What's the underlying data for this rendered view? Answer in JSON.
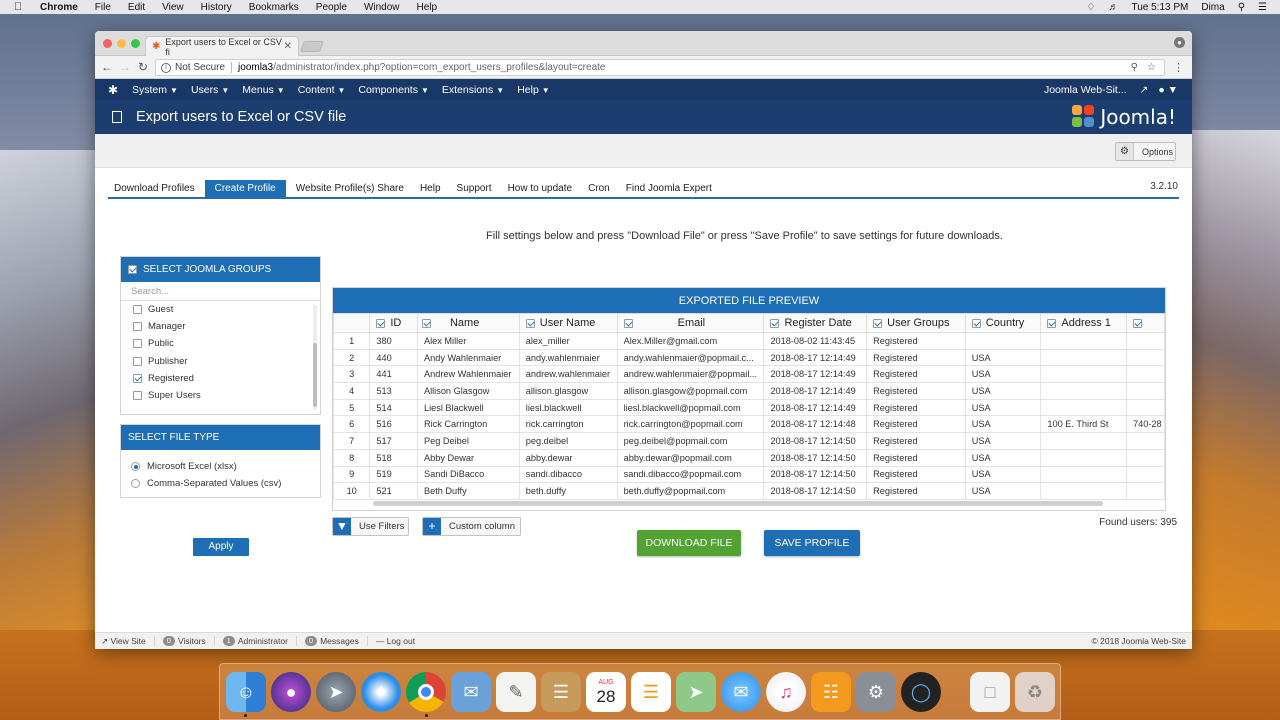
{
  "menubar": {
    "app": "Chrome",
    "items": [
      "File",
      "Edit",
      "View",
      "History",
      "Bookmarks",
      "People",
      "Window",
      "Help"
    ],
    "clock": "Tue 5:13 PM",
    "user": "Dima"
  },
  "browser": {
    "tab_title": "Export users to Excel or CSV fi",
    "not_secure": "Not Secure",
    "url_host": "joomla3",
    "url_path": "/administrator/index.php?option=com_export_users_profiles&layout=create"
  },
  "joomla_nav": {
    "items": [
      "System",
      "Users",
      "Menus",
      "Content",
      "Components",
      "Extensions",
      "Help"
    ],
    "site_link": "Joomla Web-Sit...",
    "brand": "Joomla!"
  },
  "header": {
    "title": "Export users to Excel or CSV file"
  },
  "toolbar": {
    "options_label": "Options"
  },
  "tabs": [
    {
      "label": "Download Profiles",
      "active": false
    },
    {
      "label": "Create Profile",
      "active": true
    },
    {
      "label": "Website Profile(s) Share",
      "active": false
    },
    {
      "label": "Help",
      "active": false
    },
    {
      "label": "Support",
      "active": false
    },
    {
      "label": "How to update",
      "active": false
    },
    {
      "label": "Cron",
      "active": false
    },
    {
      "label": "Find Joomla Expert",
      "active": false
    }
  ],
  "version": "3.2.10",
  "hint": "Fill settings below and press \"Download File\" or press \"Save Profile\" to save settings for future downloads.",
  "groups_panel": {
    "title": "SELECT JOOMLA GROUPS",
    "search_placeholder": "Search...",
    "groups": [
      {
        "label": "Guest",
        "checked": false
      },
      {
        "label": "Manager",
        "checked": false
      },
      {
        "label": "Public",
        "checked": false
      },
      {
        "label": "Publisher",
        "checked": false
      },
      {
        "label": "Registered",
        "checked": true
      },
      {
        "label": "Super Users",
        "checked": false
      }
    ]
  },
  "filetype_panel": {
    "title": "SELECT FILE TYPE",
    "options": [
      {
        "label": "Microsoft Excel (xlsx)",
        "selected": true
      },
      {
        "label": "Comma-Separated Values (csv)",
        "selected": false
      }
    ],
    "apply_label": "Apply"
  },
  "preview": {
    "title": "EXPORTED FILE PREVIEW",
    "columns": [
      "",
      "ID",
      "Name",
      "User Name",
      "Email",
      "Register Date",
      "User Groups",
      "Country",
      "Address 1",
      ""
    ],
    "rows": [
      [
        "1",
        "380",
        "Alex Miller",
        "alex_miller",
        "Alex.Miller@gmail.com",
        "2018-08-02 11:43:45",
        "Registered",
        "",
        "",
        ""
      ],
      [
        "2",
        "440",
        "Andy Wahlenmaier",
        "andy.wahlenmaier",
        "andy.wahlenmaier@popmail.c...",
        "2018-08-17 12:14:49",
        "Registered",
        "USA",
        "",
        ""
      ],
      [
        "3",
        "441",
        "Andrew Wahlenmaier",
        "andrew.wahlenmaier",
        "andrew.wahlenmaier@popmail...",
        "2018-08-17 12:14:49",
        "Registered",
        "USA",
        "",
        ""
      ],
      [
        "4",
        "513",
        "Allison Glasgow",
        "allison.glasgow",
        "allison.glasgow@popmail.com",
        "2018-08-17 12:14:49",
        "Registered",
        "USA",
        "",
        ""
      ],
      [
        "5",
        "514",
        "Liesl Blackwell",
        "liesl.blackwell",
        "liesl.blackwell@popmail.com",
        "2018-08-17 12:14:49",
        "Registered",
        "USA",
        "",
        ""
      ],
      [
        "6",
        "516",
        "Rick Carrington",
        "rick.carrington",
        "rick.carrington@popmail.com",
        "2018-08-17 12:14:48",
        "Registered",
        "USA",
        "100 E. Third St",
        "740-28"
      ],
      [
        "7",
        "517",
        "Peg Deibel",
        "peg.deibel",
        "peg.deibel@popmail.com",
        "2018-08-17 12:14:50",
        "Registered",
        "USA",
        "",
        ""
      ],
      [
        "8",
        "518",
        "Abby Dewar",
        "abby.dewar",
        "abby.dewar@popmail.com",
        "2018-08-17 12:14:50",
        "Registered",
        "USA",
        "",
        ""
      ],
      [
        "9",
        "519",
        "Sandi DiBacco",
        "sandi.dibacco",
        "sandi.dibacco@popmail.com",
        "2018-08-17 12:14:50",
        "Registered",
        "USA",
        "",
        ""
      ],
      [
        "10",
        "521",
        "Beth Duffy",
        "beth.duffy",
        "beth.duffy@popmail.com",
        "2018-08-17 12:14:50",
        "Registered",
        "USA",
        "",
        ""
      ]
    ]
  },
  "actions": {
    "use_filters": "Use Filters",
    "custom_column": "Custom column",
    "found_users": "Found users: 395",
    "download_file": "DOWNLOAD FILE",
    "save_profile": "SAVE PROFILE"
  },
  "statusbar": {
    "view_site": "View Site",
    "visitors_count": "0",
    "visitors": "Visitors",
    "admin_count": "1",
    "administrator": "Administrator",
    "messages_count": "0",
    "messages": "Messages",
    "logout": "Log out",
    "copyright": "© 2018 Joomla Web-Site"
  },
  "dock": {
    "calendar_month": "AUG",
    "calendar_day": "28",
    "apps": [
      "Finder",
      "Siri",
      "Launchpad",
      "Safari",
      "Chrome",
      "Mail",
      "TextEdit",
      "Notes",
      "Calendar",
      "Reminders",
      "Maps",
      "Messages",
      "iTunes",
      "iBooks",
      "System Preferences",
      "QuickTime",
      "Document",
      "Trash"
    ]
  }
}
